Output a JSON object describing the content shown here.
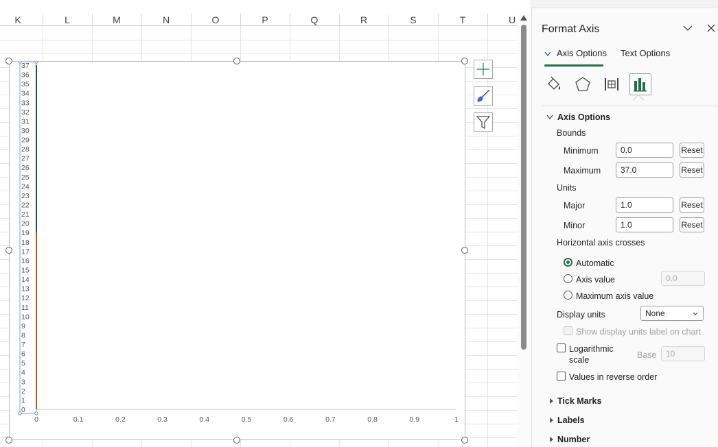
{
  "columns": [
    "K",
    "L",
    "M",
    "N",
    "O",
    "P",
    "Q",
    "R",
    "S",
    "T",
    "U"
  ],
  "chart_data": {
    "type": "line",
    "y_ticks": [
      "0",
      "1",
      "2",
      "3",
      "4",
      "5",
      "6",
      "7",
      "8",
      "9",
      "10",
      "11",
      "12",
      "13",
      "14",
      "15",
      "16",
      "17",
      "18",
      "19",
      "20",
      "21",
      "22",
      "23",
      "24",
      "25",
      "26",
      "27",
      "28",
      "29",
      "30",
      "31",
      "32",
      "33",
      "34",
      "35",
      "36",
      "37"
    ],
    "x_ticks": [
      "0",
      "0.1",
      "0.2",
      "0.3",
      "0.4",
      "0.5",
      "0.6",
      "0.7",
      "0.8",
      "0.9",
      "1"
    ],
    "ylim": [
      0,
      37
    ],
    "xlim": [
      0,
      1
    ],
    "series": [
      {
        "color": "#c55a11",
        "x": [
          0,
          0
        ],
        "y": [
          0,
          19
        ]
      },
      {
        "color": "#1f4e79",
        "x": [
          0,
          0
        ],
        "y": [
          19,
          37
        ]
      }
    ]
  },
  "pane": {
    "title": "Format Axis",
    "tabs": {
      "axis_options": "Axis Options",
      "text_options": "Text Options"
    },
    "section_title": "Axis Options",
    "bounds_label": "Bounds",
    "minimum_label": "Minimum",
    "minimum_value": "0.0",
    "maximum_label": "Maximum",
    "maximum_value": "37.0",
    "units_label": "Units",
    "major_label": "Major",
    "major_value": "1.0",
    "minor_label": "Minor",
    "minor_value": "1.0",
    "reset_label": "Reset",
    "crosses_label": "Horizontal axis crosses",
    "automatic_label": "Automatic",
    "axis_value_label": "Axis value",
    "axis_value_value": "0.0",
    "max_axis_value_label": "Maximum axis value",
    "display_units_label": "Display units",
    "display_units_value": "None",
    "show_units_label": "Show display units label on chart",
    "log_label_1": "Logarithmic",
    "log_label_2": "scale",
    "base_label": "Base",
    "base_value": "10",
    "reverse_label": "Values in reverse order",
    "tick_marks_label": "Tick Marks",
    "labels_label": "Labels",
    "number_label": "Number"
  },
  "colors": {
    "accent": "#1e7145",
    "plus": "#2e9a4f",
    "brush": "#2f6fbf"
  }
}
